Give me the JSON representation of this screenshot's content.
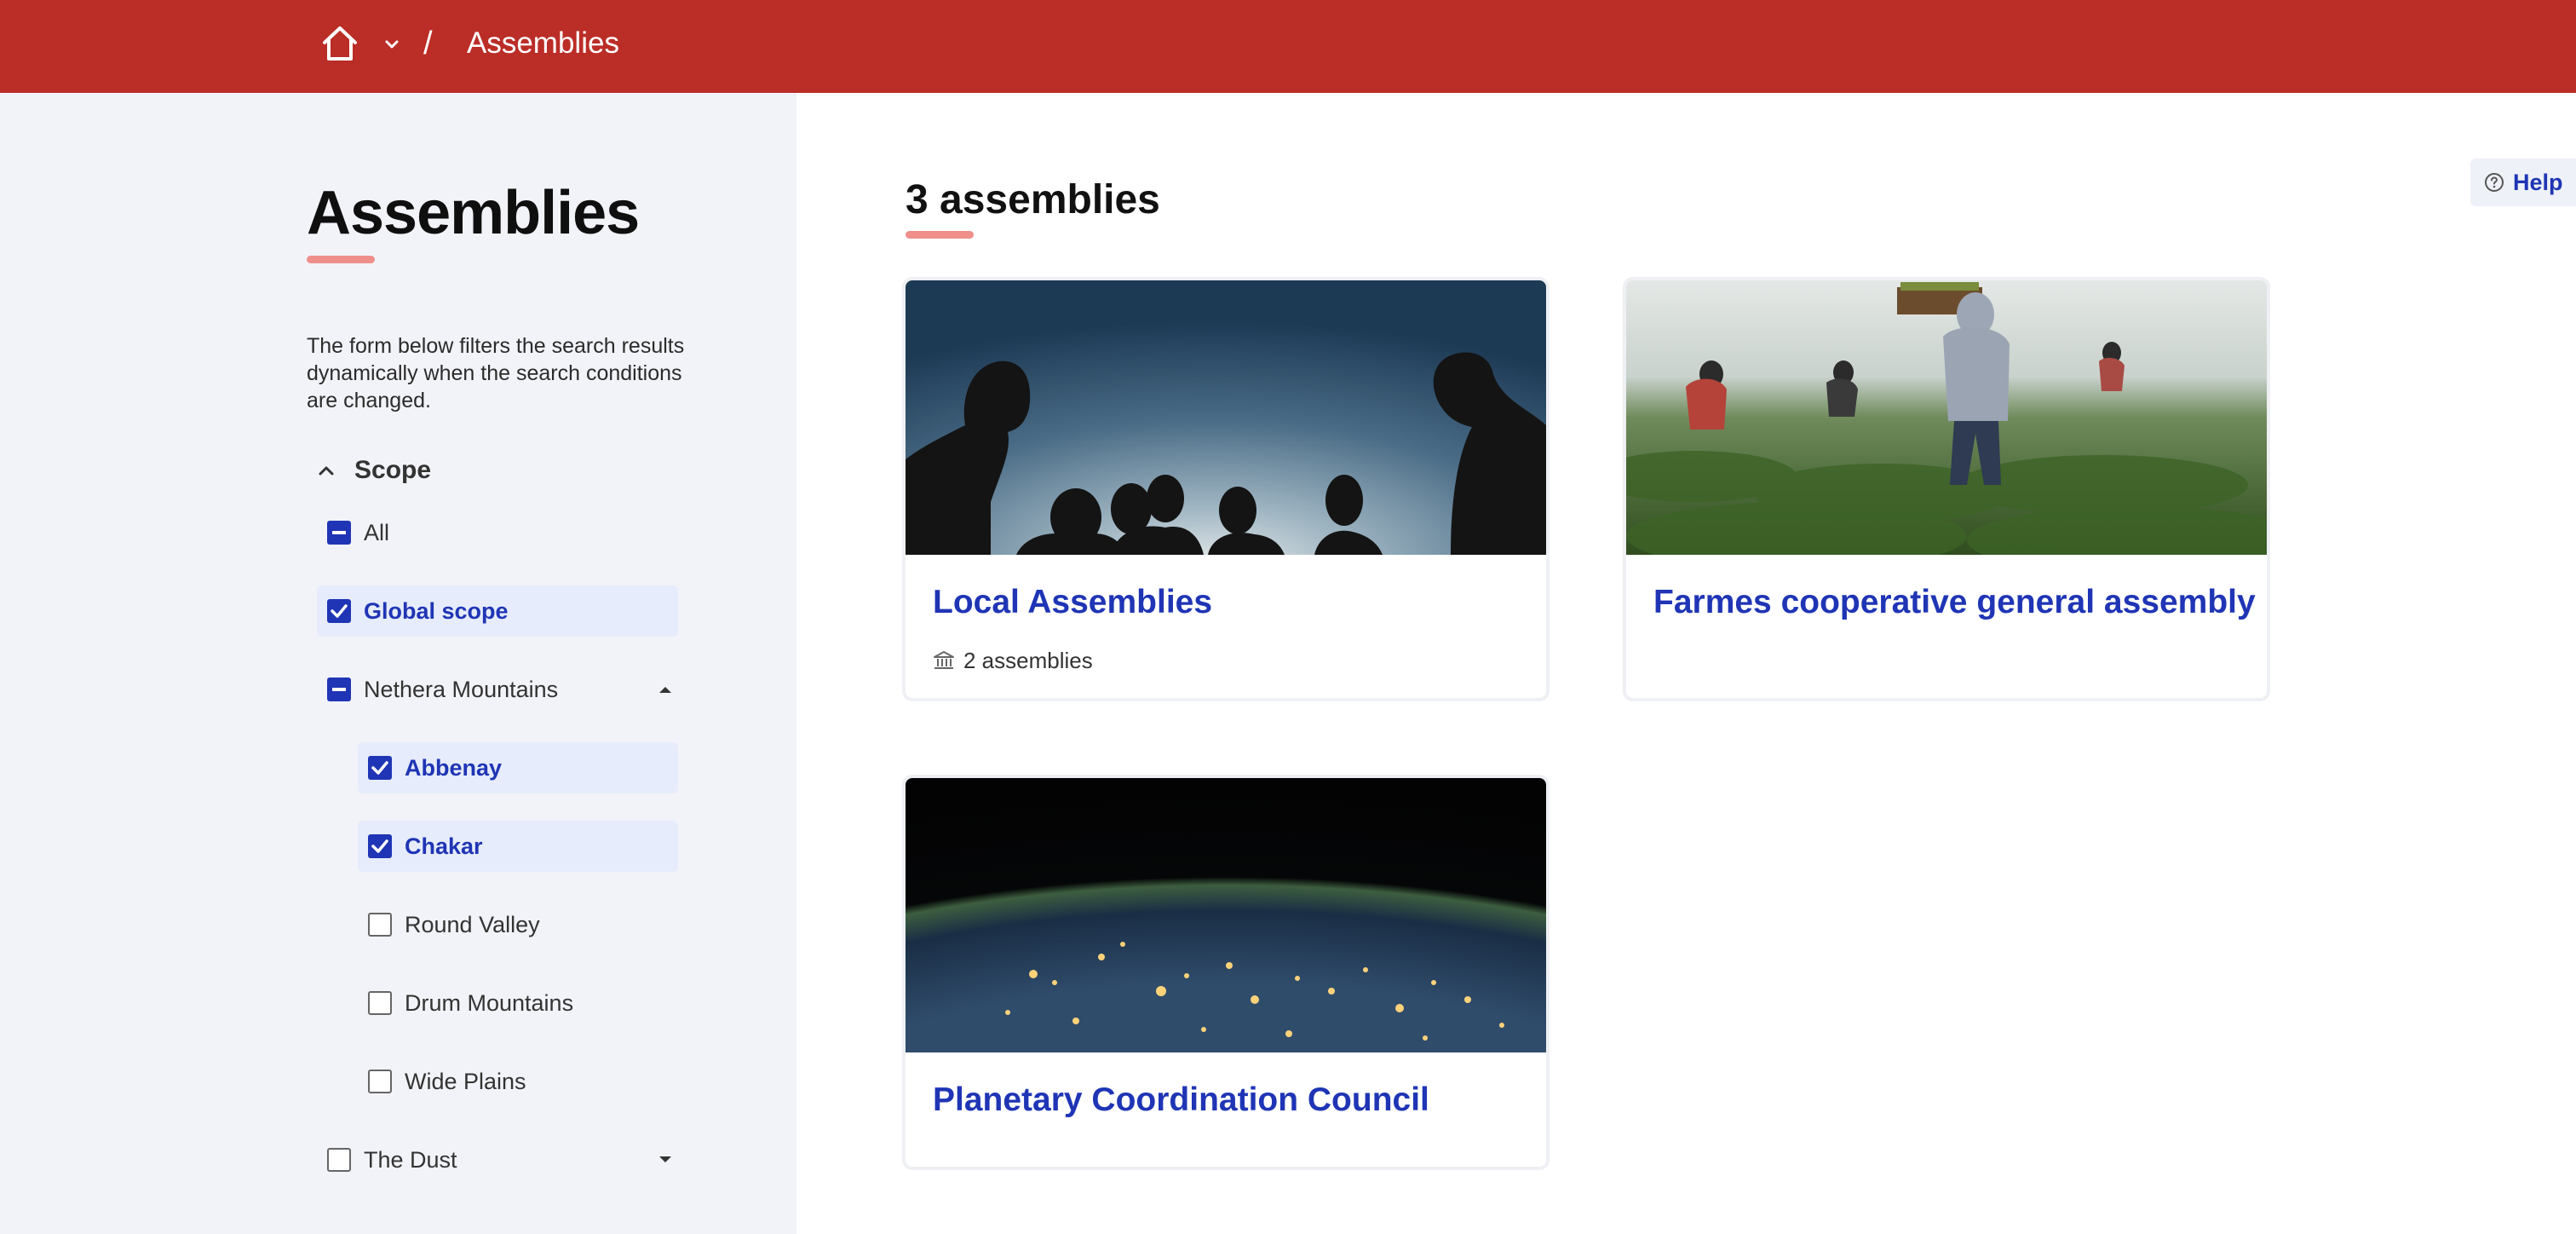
{
  "breadcrumb": {
    "separator": "/",
    "current": "Assemblies"
  },
  "sidebar": {
    "title": "Assemblies",
    "help_text": "The form below filters the search results dynamically when the search conditions are changed.",
    "scope_label": "Scope",
    "filters": {
      "all": "All",
      "global": "Global scope",
      "nethera": "Nethera Mountains",
      "abbenay": "Abbenay",
      "chakar": "Chakar",
      "round_valley": "Round Valley",
      "drum_mountains": "Drum Mountains",
      "wide_plains": "Wide Plains",
      "the_dust": "The Dust"
    }
  },
  "main": {
    "count_text": "3 assemblies",
    "help_label": "Help",
    "cards": [
      {
        "title": "Local Assemblies",
        "meta": "2 assemblies",
        "image": "silhouettes-at-dusk"
      },
      {
        "title": "Farmes cooperative general assembly",
        "image": "field-workers"
      },
      {
        "title": "Planetary Coordination Council",
        "image": "earth-at-night"
      }
    ]
  },
  "colors": {
    "topbar": "#bb2d27",
    "accent_underline": "#ef8f8a",
    "link_blue": "#1f35b5",
    "sidebar_bg": "#f2f3f8"
  }
}
